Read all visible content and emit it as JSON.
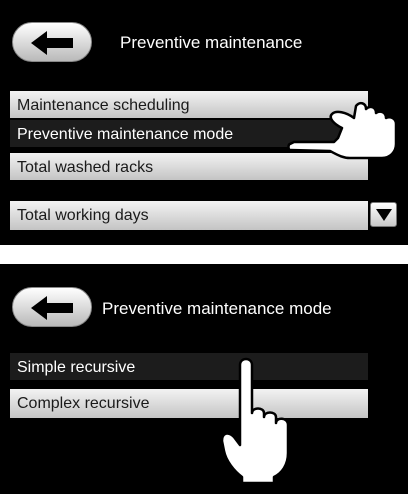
{
  "panel_1": {
    "title": "Preventive maintenance",
    "items": [
      {
        "label": "Maintenance scheduling",
        "selected": false
      },
      {
        "label": "Preventive maintenance mode",
        "selected": true
      },
      {
        "label": "Total washed racks",
        "selected": false
      },
      {
        "label": "Total working days",
        "selected": false
      }
    ]
  },
  "panel_2": {
    "title": "Preventive maintenance mode",
    "items": [
      {
        "label": "Simple recursive",
        "selected": true
      },
      {
        "label": "Complex recursive",
        "selected": false
      }
    ]
  },
  "icons": {
    "back": "arrow-left-icon",
    "scroll": "triangle-down-icon",
    "pointer": "hand-pointer-icon"
  }
}
